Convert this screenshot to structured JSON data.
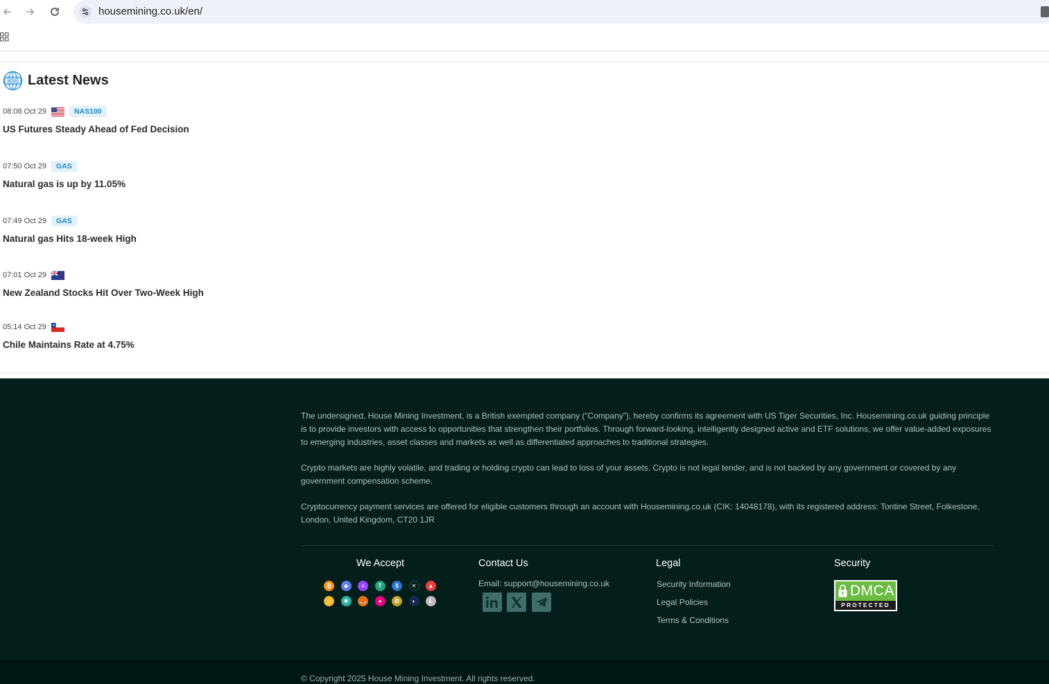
{
  "browser": {
    "url": "housemining.co.uk/en/"
  },
  "news": {
    "title": "Latest News",
    "items": [
      {
        "time": "08:08 Oct 29",
        "flag": "us",
        "tag": "NAS100",
        "headline": "US Futures Steady Ahead of Fed Decision"
      },
      {
        "time": "07:50 Oct 29",
        "flag": "",
        "tag": "GAS",
        "headline": "Natural gas is up by 11.05%"
      },
      {
        "time": "07:49 Oct 29",
        "flag": "",
        "tag": "GAS",
        "headline": "Natural gas Hits 18-week High"
      },
      {
        "time": "07:01 Oct 29",
        "flag": "nz",
        "tag": "",
        "headline": "New Zealand Stocks Hit Over Two-Week High"
      },
      {
        "time": "05:14 Oct 29",
        "flag": "cl",
        "tag": "",
        "headline": "Chile Maintains Rate at 4.75%"
      }
    ]
  },
  "footer": {
    "paragraphs": [
      "The undersigned, House Mining Investment, is a British exempted company (“Company”), hereby confirms its agreement with US Tiger Securities, Inc. Housemining.co.uk guiding principle is to provide investors with access to opportunities that strengthen their portfolios. Through forward-looking, intelligently designed active and ETF solutions, we offer value-added exposures to emerging industries, asset classes and markets as well as differentiated approaches to traditional strategies.",
      "Crypto markets are highly volatile, and trading or holding crypto can lead to loss of your assets. Crypto is not legal tender, and is not backed by any government or covered by any government compensation scheme.",
      "Cryptocurrency payment services are offered for eligible customers through an account with Housemining.co.uk (CIK: 14048178), with its registered address: Tontine Street, Folkestone, London, United Kingdom, CT20 1JR"
    ],
    "we_accept": {
      "title": "We Accept",
      "coins": [
        {
          "icon": "bitcoin-icon",
          "color": "#f7931a",
          "glyph": "₿"
        },
        {
          "icon": "ethereum-icon",
          "color": "#627eea",
          "glyph": "◆"
        },
        {
          "icon": "solana-icon",
          "color": "#9945ff",
          "glyph": "≡"
        },
        {
          "icon": "tether-icon",
          "color": "#26a17b",
          "glyph": "T"
        },
        {
          "icon": "usdc-icon",
          "color": "#2775ca",
          "glyph": "$"
        },
        {
          "icon": "xrp-icon",
          "color": "#031e1b",
          "glyph": "✕"
        },
        {
          "icon": "avalanche-icon",
          "color": "#e84142",
          "glyph": "▲"
        },
        {
          "icon": "bnb-icon",
          "color": "#f3ba2f",
          "glyph": "◇"
        },
        {
          "icon": "cosmos-icon",
          "color": "#2fb3a5",
          "glyph": "✺"
        },
        {
          "icon": "metamask-icon",
          "color": "#e2761b",
          "glyph": "🦊"
        },
        {
          "icon": "polkadot-icon",
          "color": "#e6007a",
          "glyph": "●"
        },
        {
          "icon": "dogecoin-icon",
          "color": "#c2a633",
          "glyph": "Ð"
        },
        {
          "icon": "terra-icon",
          "color": "#172852",
          "glyph": "◐"
        },
        {
          "icon": "litecoin-icon",
          "color": "#bfbbbb",
          "glyph": "Ł"
        }
      ]
    },
    "contact": {
      "title": "Contact Us",
      "email": "Email: support@housemining.co.uk"
    },
    "legal": {
      "title": "Legal",
      "links": [
        "Security Information",
        "Legal Policies",
        "Terms & Conditions"
      ]
    },
    "security": {
      "title": "Security",
      "badge_word": "DMCA",
      "badge_sub": "PROTECTED"
    },
    "copyright": "© Copyright 2025 House Mining Investment. All rights reserved."
  }
}
